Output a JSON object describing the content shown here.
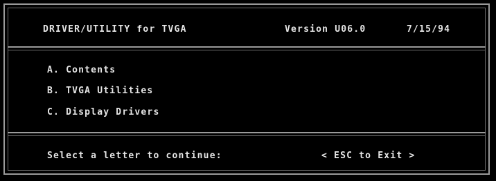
{
  "header": {
    "title": "DRIVER/UTILITY for TVGA",
    "version": "Version U06.0",
    "date": "7/15/94"
  },
  "menu": {
    "items": [
      {
        "label": "A. Contents"
      },
      {
        "label": "B. TVGA Utilities"
      },
      {
        "label": "C. Display Drivers"
      }
    ]
  },
  "footer": {
    "prompt": "Select a letter to continue:",
    "exit_label": "< ESC to Exit >"
  },
  "colors": {
    "background": "#000000",
    "text": "#e6e6e6",
    "frame": "#9a9a9a"
  }
}
